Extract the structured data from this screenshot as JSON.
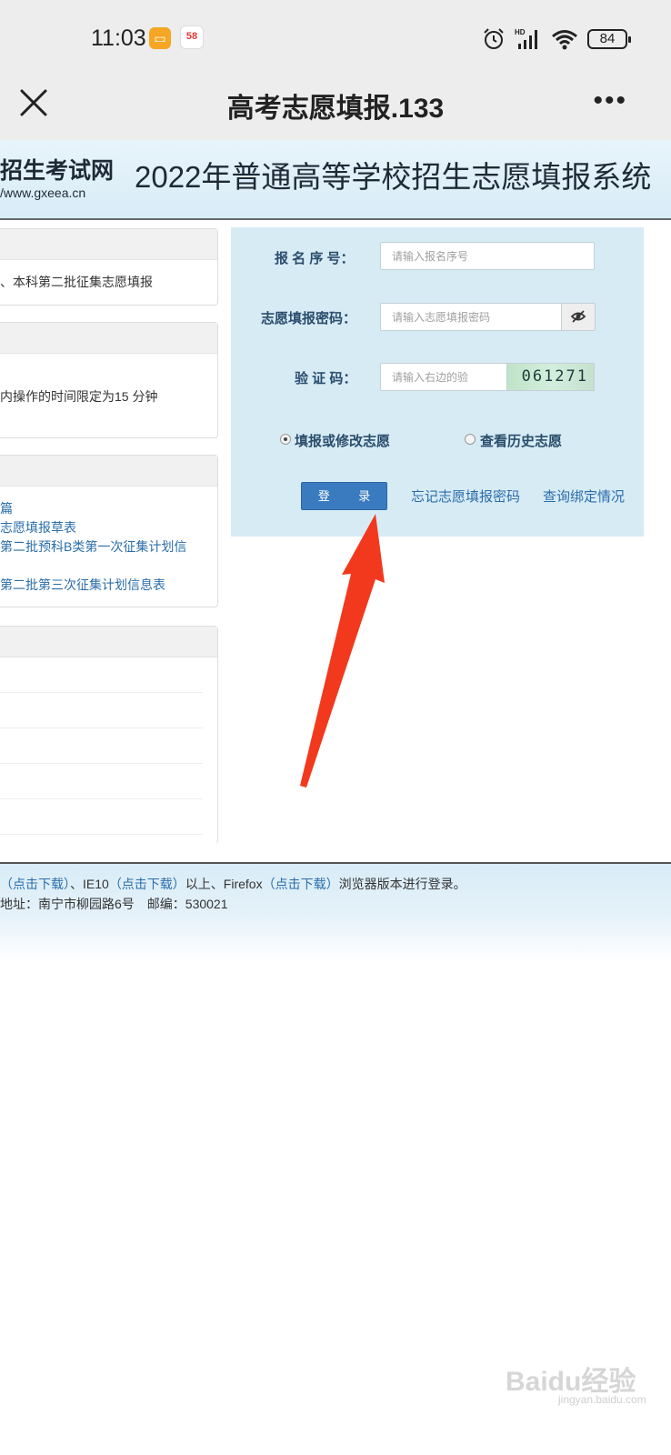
{
  "status_bar": {
    "time": "11:03",
    "notif_app_2": "58",
    "battery": "84",
    "network_label": "HD"
  },
  "title_bar": {
    "title": "高考志愿填报.133"
  },
  "banner": {
    "logo_title": "招生考试网",
    "logo_url": "/www.gxeea.cn",
    "system_title": "2022年普通高等学校招生志愿填报系统"
  },
  "left_panels": {
    "panel1_text": "、本科第二批征集志愿填报",
    "panel2_text": "内操作的时间限定为15 分钟",
    "panel3_links": [
      "篇",
      "志愿填报草表",
      "第二批预科B类第一次征集计划信",
      "第二批第三次征集计划信息表"
    ]
  },
  "login": {
    "reg_label": "报 名 序 号：",
    "reg_placeholder": "请输入报名序号",
    "pwd_label": "志愿填报密码：",
    "pwd_placeholder": "请输入志愿填报密码",
    "captcha_label": "验 证 码：",
    "captcha_placeholder": "请输入右边的验",
    "captcha_code": "061271",
    "radio_fill": "填报或修改志愿",
    "radio_history": "查看历史志愿",
    "login_button": "登 录",
    "forgot_link": "忘记志愿填报密码",
    "binding_link": "查询绑定情况"
  },
  "footer": {
    "line1_dl1": "（点击下载）",
    "line1_mid": "、IE10",
    "line1_dl2": "（点击下载）",
    "line1_mid2": "以上、Firefox",
    "line1_dl3": "（点击下载）",
    "line1_end": "浏览器版本进行登录。",
    "line2": "地址：南宁市柳园路6号　邮编：530021"
  },
  "watermark": {
    "brand": "Baidu经验",
    "sub": "jingyan.baidu.com"
  },
  "colors": {
    "arrow": "#f2391e",
    "link": "#2a6ea9",
    "panel_bg": "#d7ebf5",
    "button": "#3a7bc0"
  }
}
